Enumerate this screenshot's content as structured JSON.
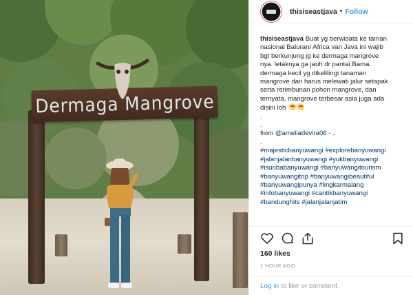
{
  "photo": {
    "sign_text": "Dermaga Mangrove"
  },
  "header": {
    "username": "thisiseastjava",
    "separator": "•",
    "follow_label": "Follow"
  },
  "caption": {
    "username": "thisiseastjava",
    "lines": [
      "Buat yg berwisata ke taman",
      "nasional Baluran/ Africa van Java ini wajib",
      "bgt berkunjung jg ke dermaga mangrove",
      "nya. letaknya ga jauh dr pantai Bama.",
      "dermaga kecil yg dikelilingi tanaman",
      "mangrove dan harus melewati jalur setapak",
      "serta rerimbunan pohon mangrove, dan",
      "ternyata, mangrove terbesar asia juga ada",
      "disini loh"
    ],
    "dot1": ".",
    "dot2": ".",
    "from_prefix": "from",
    "from_mention": "@ameliadevira06",
    "from_suffix": "- .",
    "dot3": ".",
    "hashtags": [
      "#majesticbanyuwangi #explorebanyuwangi",
      "#jalanjalanbanyuwangi #yukbanyuwangi",
      "#isunbabanyuwangi #banyuwangitourism",
      "#banyuwangitrip #banyuwangibeautiful",
      "#banyuwangipunya #lingkarmalang",
      "#infobanyuwangi #cantikbanyuwangi",
      "#bandunghits #jalanjalanjatim"
    ]
  },
  "actions": {
    "like_icon": "heart-icon",
    "comment_icon": "comment-icon",
    "share_icon": "share-icon",
    "save_icon": "bookmark-icon"
  },
  "likes_text": "160 likes",
  "time_text": "1 HOUR AGO",
  "comment": {
    "login_link": "Log in",
    "rest": "to like or comment."
  },
  "colors": {
    "link_blue": "#3897f0",
    "hashtag_blue": "#003569",
    "meta_gray": "#999999"
  }
}
